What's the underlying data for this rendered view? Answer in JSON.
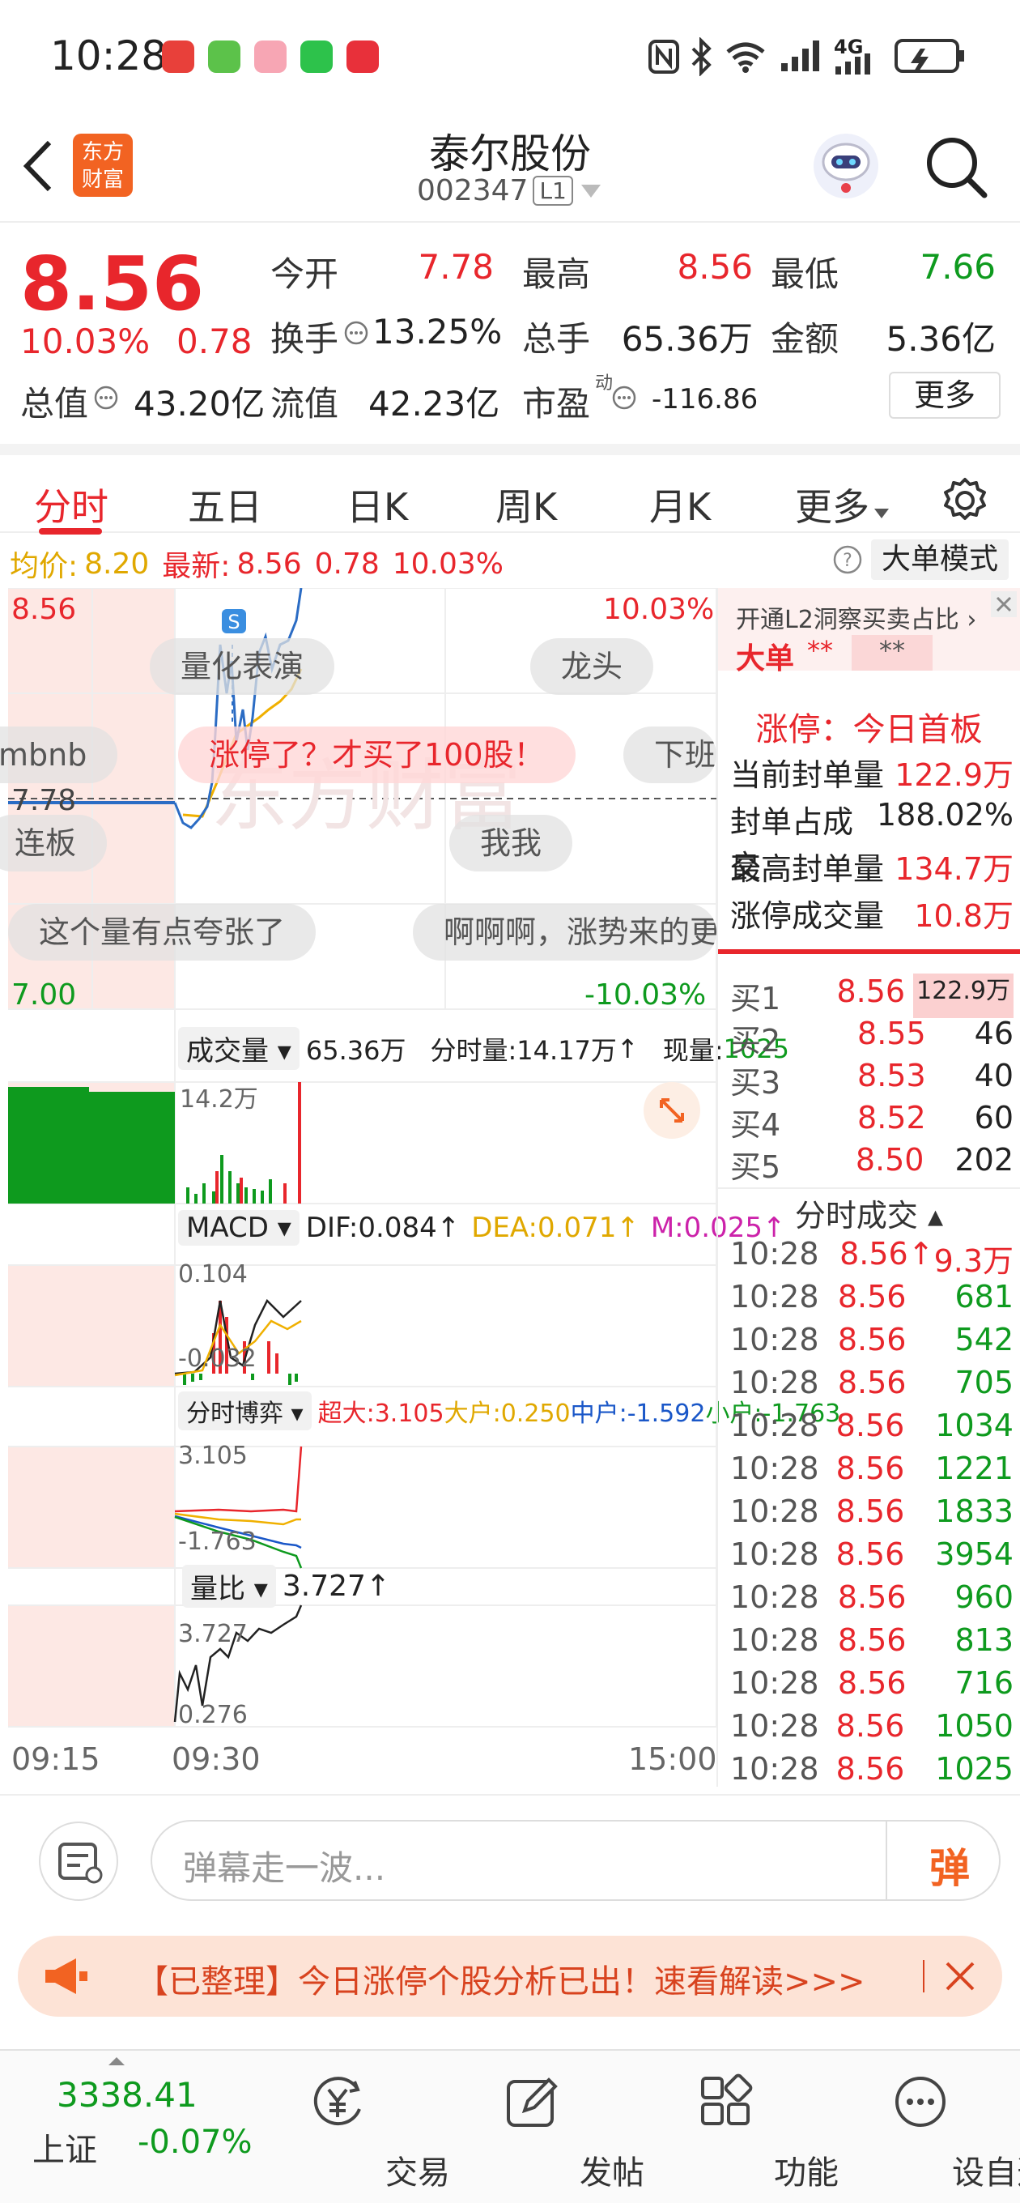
{
  "status_bar": {
    "time": "10:28",
    "network": "4G"
  },
  "header": {
    "title": "泰尔股份",
    "code": "002347",
    "level_badge": "L1",
    "logo_text": "东方财富"
  },
  "quote": {
    "price": "8.56",
    "change_pct": "10.03%",
    "change": "0.78",
    "open_label": "今开",
    "open": "7.78",
    "high_label": "最高",
    "high": "8.56",
    "low_label": "最低",
    "low": "7.66",
    "turnover_label": "换手",
    "turnover": "13.25%",
    "volume_label": "总手",
    "volume": "65.36万",
    "amount_label": "金额",
    "amount": "5.36亿",
    "mktcap_label": "总值",
    "mktcap": "43.20亿",
    "float_label": "流值",
    "float": "42.23亿",
    "pe_label": "市盈",
    "pe_sup": "动",
    "pe": "-116.86",
    "more_button": "更多"
  },
  "tabs": [
    {
      "label": "分时"
    },
    {
      "label": "五日"
    },
    {
      "label": "日K"
    },
    {
      "label": "周K"
    },
    {
      "label": "月K"
    },
    {
      "label": "更多"
    }
  ],
  "chart_info": {
    "avg_label": "均价:",
    "avg": "8.20",
    "latest_label": "最新:",
    "latest": "8.56",
    "latest_chg": "0.78",
    "latest_pct": "10.03%",
    "mode_button": "大单模式"
  },
  "price_chart": {
    "top_price": "8.56",
    "mid_price": "7.78",
    "bottom_price": "7.00",
    "top_pct": "10.03%",
    "bottom_pct": "-10.03%",
    "watermark": "东方财富"
  },
  "danmu": [
    "量化表演",
    "龙头",
    "mbnb",
    "涨停了？才买了100股！",
    "下班",
    "连板",
    "我我",
    "这个量有点夸张了",
    "啊啊啊，涨势来的更"
  ],
  "volume_panel": {
    "label": "成交量",
    "total": "65.36万",
    "minute_label": "分时量:",
    "minute": "14.17万",
    "now_label": "现量:",
    "now": "1025",
    "axis_max": "14.2万"
  },
  "macd_panel": {
    "label": "MACD",
    "dif": "DIF:0.084",
    "dea": "DEA:0.071",
    "m": "M:0.025",
    "axis_top": "0.104",
    "axis_bottom": "-0.032"
  },
  "fund_panel": {
    "label": "分时博弈",
    "super": "超大:3.105",
    "large": "大户:0.250",
    "mid": "中户:-1.592",
    "small": "小户:-1.763",
    "axis_top": "3.105",
    "axis_bottom": "-1.763"
  },
  "ratio_panel": {
    "label": "量比",
    "value": "3.727",
    "axis_top": "3.727",
    "axis_bottom": "0.276"
  },
  "time_axis": {
    "t1": "09:15",
    "t2": "09:30",
    "t3": "15:00"
  },
  "right_panel": {
    "l2_link": "开通L2洞察买卖占比",
    "big_order_label": "大单",
    "big_order_val1": "**",
    "big_order_val2": "**",
    "limit_title": "涨停：今日首板",
    "stats": [
      {
        "label": "当前封单量",
        "value": "122.9万"
      },
      {
        "label": "封单占成交",
        "value": "188.02%"
      },
      {
        "label": "最高封单量",
        "value": "134.7万"
      },
      {
        "label": "涨停成交量",
        "value": "10.8万"
      }
    ],
    "bids": [
      {
        "label": "买1",
        "price": "8.56",
        "vol": "122.9万"
      },
      {
        "label": "买2",
        "price": "8.55",
        "vol": "46"
      },
      {
        "label": "买3",
        "price": "8.53",
        "vol": "40"
      },
      {
        "label": "买4",
        "price": "8.52",
        "vol": "60"
      },
      {
        "label": "买5",
        "price": "8.50",
        "vol": "202"
      }
    ],
    "trades_title": "分时成交",
    "trades": [
      {
        "time": "10:28",
        "price": "8.56",
        "vol": "9.3万"
      },
      {
        "time": "10:28",
        "price": "8.56",
        "vol": "681"
      },
      {
        "time": "10:28",
        "price": "8.56",
        "vol": "542"
      },
      {
        "time": "10:28",
        "price": "8.56",
        "vol": "705"
      },
      {
        "time": "10:28",
        "price": "8.56",
        "vol": "1034"
      },
      {
        "time": "10:28",
        "price": "8.56",
        "vol": "1221"
      },
      {
        "time": "10:28",
        "price": "8.56",
        "vol": "1833"
      },
      {
        "time": "10:28",
        "price": "8.56",
        "vol": "3954"
      },
      {
        "time": "10:28",
        "price": "8.56",
        "vol": "960"
      },
      {
        "time": "10:28",
        "price": "8.56",
        "vol": "813"
      },
      {
        "time": "10:28",
        "price": "8.56",
        "vol": "716"
      },
      {
        "time": "10:28",
        "price": "8.56",
        "vol": "1050"
      },
      {
        "time": "10:28",
        "price": "8.56",
        "vol": "1025"
      }
    ]
  },
  "danmu_input": {
    "placeholder": "弹幕走一波...",
    "send_label": "弹"
  },
  "notice": {
    "text": "【已整理】今日涨停个股分析已出！速看解读>>>"
  },
  "bottom_nav": {
    "index_value": "3338.41",
    "index_name": "上证",
    "index_pct": "-0.07%",
    "items": [
      {
        "label": "交易"
      },
      {
        "label": "发帖"
      },
      {
        "label": "功能"
      },
      {
        "label": "设自选"
      }
    ]
  },
  "colors": {
    "up": "#e8262c",
    "down": "#0e9a1e",
    "avg_line": "#f0b000",
    "price_line": "#2b6cc4",
    "accent": "#f26322"
  }
}
